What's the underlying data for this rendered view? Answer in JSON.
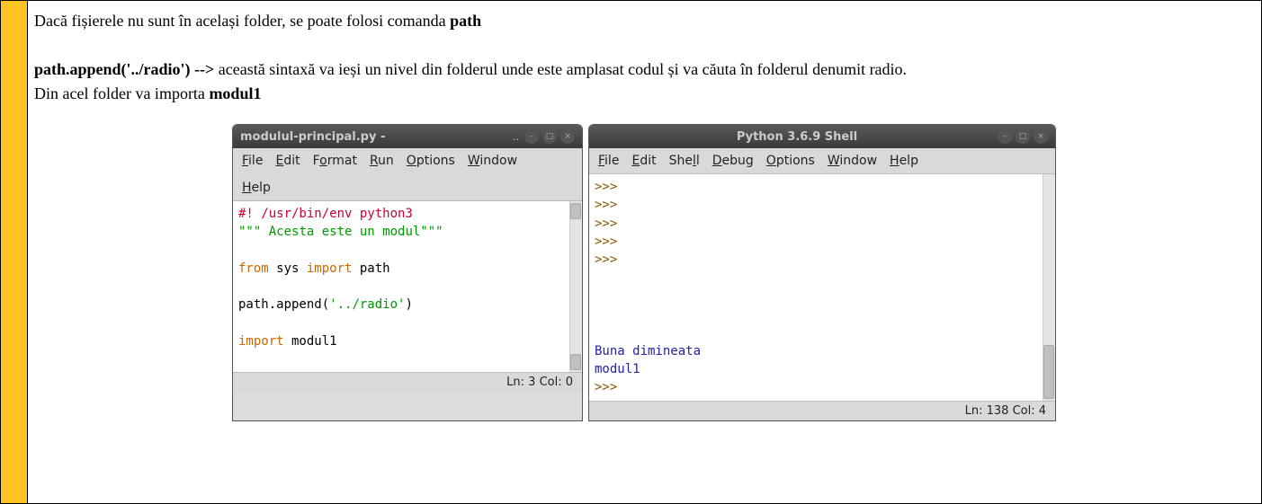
{
  "text": {
    "line1_a": "Dacă fișierele nu sunt în același folder, se poate folosi comanda ",
    "line1_b": "path",
    "line2_a": "path.append('../radio')  -->",
    "line2_b": " această sintaxă va ieși un nivel din folderul unde este amplasat codul și va căuta în folderul denumit radio.",
    "line3_a": "Din acel folder va importa ",
    "line3_b": "modul1"
  },
  "left_window": {
    "title": "modulul-principal.py -",
    "dots": "..",
    "menus": [
      "File",
      "Edit",
      "Format",
      "Run",
      "Options",
      "Window",
      "Help"
    ],
    "status": "Ln: 3  Col: 0",
    "code": {
      "l1": "#! /usr/bin/env python3",
      "l2a": "\"\"\"",
      "l2b": " Acesta este un modul",
      "l2c": "\"\"\"",
      "l3a": "from",
      "l3b": " sys ",
      "l3c": "import",
      "l3d": " path",
      "l4a": "path.append(",
      "l4b": "'../radio'",
      "l4c": ")",
      "l5a": "import",
      "l5b": " modul1"
    }
  },
  "right_window": {
    "title": "Python 3.6.9 Shell",
    "menus": [
      "File",
      "Edit",
      "Shell",
      "Debug",
      "Options",
      "Window",
      "Help"
    ],
    "status": "Ln: 138  Col: 4",
    "shell": {
      "prompt": ">>>",
      "blankspacer": " ",
      "out1": "Buna dimineata",
      "out2": "modul1"
    }
  },
  "win_controls": {
    "min": "–",
    "max": "□",
    "close": "×"
  }
}
